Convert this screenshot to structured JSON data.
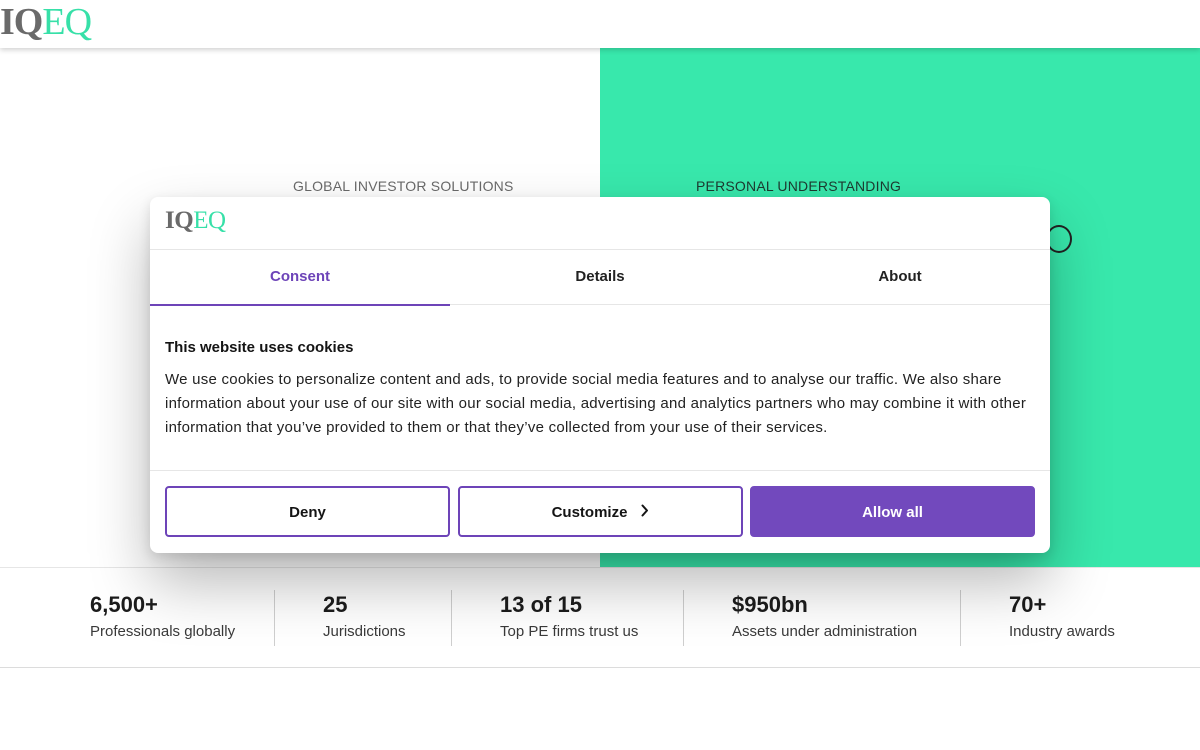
{
  "header": {
    "logo_iq": "IQ",
    "logo_eq": "EQ"
  },
  "hero": {
    "left_label": "GLOBAL INVESTOR SOLUTIONS",
    "right_label": "PERSONAL UNDERSTANDING"
  },
  "stats": [
    {
      "value": "6,500+",
      "label": "Professionals globally"
    },
    {
      "value": "25",
      "label": "Jurisdictions"
    },
    {
      "value": "13 of 15",
      "label": "Top PE firms trust us"
    },
    {
      "value": "$950bn",
      "label": "Assets under administration"
    },
    {
      "value": "70+",
      "label": "Industry awards"
    }
  ],
  "cookie_dialog": {
    "logo_iq": "IQ",
    "logo_eq": "EQ",
    "tabs": [
      {
        "label": "Consent",
        "active": true
      },
      {
        "label": "Details",
        "active": false
      },
      {
        "label": "About",
        "active": false
      }
    ],
    "title": "This website uses cookies",
    "body": "We use cookies to personalize content and ads, to provide social media features and to analyse our traffic. We also share information about your use of our site with our social media, advertising and analytics partners who may combine it with other information that you’ve provided to them or that they’ve collected from your use of their services.",
    "buttons": {
      "deny": "Deny",
      "customize": "Customize",
      "allow_all": "Allow all"
    }
  },
  "colors": {
    "brand_green": "#38e8ac",
    "brand_purple": "#6d44b8",
    "logo_grey": "#6a6a6a"
  },
  "icons": {
    "customize_chevron": "chevron-right-icon"
  }
}
